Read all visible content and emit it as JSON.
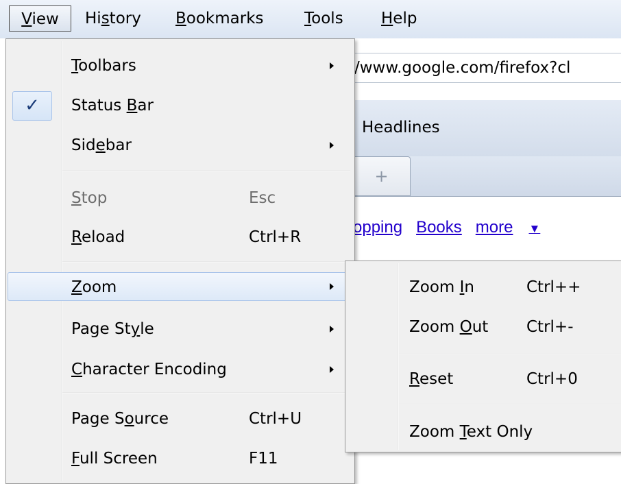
{
  "menubar": {
    "items": [
      {
        "pre": "",
        "acc": "V",
        "post": "iew"
      },
      {
        "pre": "Hi",
        "acc": "s",
        "post": "tory"
      },
      {
        "pre": "",
        "acc": "B",
        "post": "ookmarks"
      },
      {
        "pre": "",
        "acc": "T",
        "post": "ools"
      },
      {
        "pre": "",
        "acc": "H",
        "post": "elp"
      }
    ]
  },
  "browser": {
    "url_fragment": "/www.google.com/firefox?cl",
    "bookmark_fragment": "Headlines",
    "new_tab_symbol": "+",
    "links": [
      "opping",
      "Books",
      "more"
    ],
    "more_arrow": "▼"
  },
  "view_menu": {
    "check_mark": "✓",
    "items": [
      {
        "pre": "",
        "acc": "T",
        "post": "oolbars",
        "shortcut": "",
        "submenu": true,
        "state": "normal"
      },
      {
        "pre": "Status ",
        "acc": "B",
        "post": "ar",
        "shortcut": "",
        "submenu": false,
        "state": "checked"
      },
      {
        "pre": "Sid",
        "acc": "e",
        "post": "bar",
        "shortcut": "",
        "submenu": true,
        "state": "normal"
      },
      {
        "pre": "",
        "acc": "S",
        "post": "top",
        "shortcut": "Esc",
        "submenu": false,
        "state": "disabled"
      },
      {
        "pre": "",
        "acc": "R",
        "post": "eload",
        "shortcut": "Ctrl+R",
        "submenu": false,
        "state": "normal"
      },
      {
        "pre": "",
        "acc": "Z",
        "post": "oom",
        "shortcut": "",
        "submenu": true,
        "state": "highlighted"
      },
      {
        "pre": "Page St",
        "acc": "y",
        "post": "le",
        "shortcut": "",
        "submenu": true,
        "state": "normal"
      },
      {
        "pre": "",
        "acc": "C",
        "post": "haracter Encoding",
        "shortcut": "",
        "submenu": true,
        "state": "normal"
      },
      {
        "pre": "Page S",
        "acc": "o",
        "post": "urce",
        "shortcut": "Ctrl+U",
        "submenu": false,
        "state": "normal"
      },
      {
        "pre": "",
        "acc": "F",
        "post": "ull Screen",
        "shortcut": "F11",
        "submenu": false,
        "state": "normal"
      }
    ]
  },
  "zoom_submenu": {
    "items": [
      {
        "pre": "Zoom ",
        "acc": "I",
        "post": "n",
        "shortcut": "Ctrl++"
      },
      {
        "pre": "Zoom ",
        "acc": "O",
        "post": "ut",
        "shortcut": "Ctrl+-"
      },
      {
        "pre": "",
        "acc": "R",
        "post": "eset",
        "shortcut": "Ctrl+0"
      },
      {
        "pre": "Zoom ",
        "acc": "T",
        "post": "ext Only",
        "shortcut": ""
      }
    ]
  }
}
